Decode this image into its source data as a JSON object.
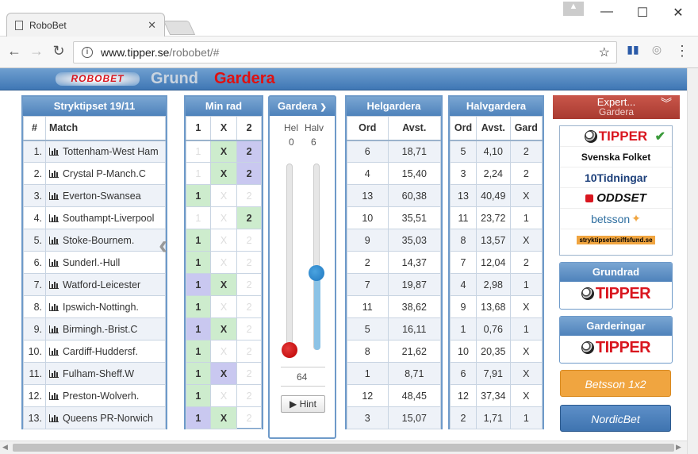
{
  "browser": {
    "tab_title": "RoboBet",
    "url_host": "www.tipper.se",
    "url_path": "/robobet/#"
  },
  "app": {
    "logo": "ROBOBET",
    "nav_grund": "Grund",
    "nav_gardera": "Gardera"
  },
  "stryktips": {
    "title": "Stryktipset 19/11",
    "col_num": "#",
    "col_match": "Match",
    "matches": [
      "Tottenham-West Ham",
      "Crystal P-Manch.C",
      "Everton-Swansea",
      "Southampt-Liverpool",
      "Stoke-Bournem.",
      "Sunderl.-Hull",
      "Watford-Leicester",
      "Ipswich-Nottingh.",
      "Birmingh.-Brist.C",
      "Cardiff-Huddersf.",
      "Fulham-Sheff.W",
      "Preston-Wolverh.",
      "Queens PR-Norwich"
    ],
    "numbers": [
      "1.",
      "2.",
      "3.",
      "4.",
      "5.",
      "6.",
      "7.",
      "8.",
      "9.",
      "10.",
      "11.",
      "12.",
      "13."
    ]
  },
  "minrad": {
    "title": "Min rad",
    "cols": [
      "1",
      "X",
      "2"
    ],
    "rows": [
      [
        "",
        "g",
        "p"
      ],
      [
        "",
        "g",
        "p"
      ],
      [
        "g",
        "",
        ""
      ],
      [
        "",
        "",
        "g"
      ],
      [
        "g",
        "",
        ""
      ],
      [
        "g",
        "",
        ""
      ],
      [
        "p",
        "g",
        ""
      ],
      [
        "g",
        "",
        ""
      ],
      [
        "p",
        "g",
        ""
      ],
      [
        "g",
        "",
        ""
      ],
      [
        "g",
        "p",
        ""
      ],
      [
        "g",
        "",
        ""
      ],
      [
        "p",
        "g",
        ""
      ]
    ]
  },
  "gardera": {
    "title": "Gardera",
    "hel_label": "Hel",
    "halv_label": "Halv",
    "hel_value": "0",
    "halv_value": "6",
    "total": "64",
    "hint_label": "Hint",
    "hel_level": 0,
    "halv_level": 0.6
  },
  "helgardera": {
    "title": "Helgardera",
    "col_ord": "Ord",
    "col_avst": "Avst.",
    "rows": [
      [
        "6",
        "18,71"
      ],
      [
        "4",
        "15,40"
      ],
      [
        "13",
        "60,38"
      ],
      [
        "10",
        "35,51"
      ],
      [
        "9",
        "35,03"
      ],
      [
        "2",
        "14,37"
      ],
      [
        "7",
        "19,87"
      ],
      [
        "11",
        "38,62"
      ],
      [
        "5",
        "16,11"
      ],
      [
        "8",
        "21,62"
      ],
      [
        "1",
        "8,71"
      ],
      [
        "12",
        "48,45"
      ],
      [
        "3",
        "15,07"
      ]
    ]
  },
  "halvgardera": {
    "title": "Halvgardera",
    "col_ord": "Ord",
    "col_avst": "Avst.",
    "col_gard": "Gard",
    "rows": [
      [
        "5",
        "4,10",
        "2"
      ],
      [
        "3",
        "2,24",
        "2"
      ],
      [
        "13",
        "40,49",
        "X"
      ],
      [
        "11",
        "23,72",
        "1"
      ],
      [
        "8",
        "13,57",
        "X"
      ],
      [
        "7",
        "12,04",
        "2"
      ],
      [
        "4",
        "2,98",
        "1"
      ],
      [
        "9",
        "13,68",
        "X"
      ],
      [
        "1",
        "0,76",
        "1"
      ],
      [
        "10",
        "20,35",
        "X"
      ],
      [
        "6",
        "7,91",
        "X"
      ],
      [
        "12",
        "37,34",
        "X"
      ],
      [
        "2",
        "1,71",
        "1"
      ]
    ]
  },
  "expert": {
    "title": "Expert...",
    "subtitle": "Gardera",
    "sources": [
      "TIPPER",
      "Svenska Folket",
      "10Tidningar",
      "ODDSET",
      "betsson",
      "stryktipsetsisiffsfund.se"
    ]
  },
  "grundrad": {
    "title": "Grundrad",
    "logo": "TIPPER"
  },
  "garderingar": {
    "title": "Garderingar",
    "logo": "TIPPER"
  },
  "betsson_btn": "Betsson 1x2",
  "nordicbet_btn": "NordicBet",
  "colors": {
    "header_blue": "#5a8cc4",
    "accent_red": "#e01010",
    "green_cell": "#cdeccd",
    "purple_cell": "#c9c8f0",
    "betsson_orange": "#f0a540",
    "nordic_blue": "#4f82bb"
  }
}
